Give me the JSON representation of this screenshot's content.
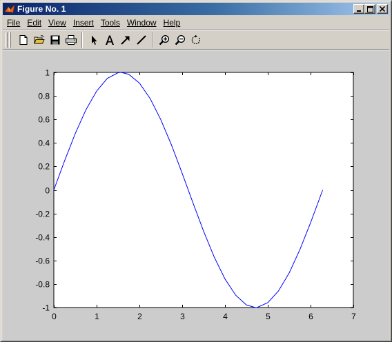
{
  "window": {
    "title": "Figure No. 1",
    "minimize_glyph": "_",
    "maximize_glyph": "□",
    "close_glyph": "×"
  },
  "menu": [
    {
      "label": "File",
      "name": "menu-file"
    },
    {
      "label": "Edit",
      "name": "menu-edit"
    },
    {
      "label": "View",
      "name": "menu-view"
    },
    {
      "label": "Insert",
      "name": "menu-insert"
    },
    {
      "label": "Tools",
      "name": "menu-tools"
    },
    {
      "label": "Window",
      "name": "menu-window"
    },
    {
      "label": "Help",
      "name": "menu-help"
    }
  ],
  "toolbar": {
    "icons": [
      "new-figure-icon",
      "open-file-icon",
      "save-icon",
      "print-icon",
      "edit-plot-arrow-icon",
      "insert-text-icon",
      "insert-arrow-icon",
      "insert-line-icon",
      "zoom-in-icon",
      "zoom-out-icon",
      "rotate-3d-icon"
    ]
  },
  "chart_data": {
    "type": "line",
    "function": "sin(x)",
    "x_range": [
      0,
      6.2832
    ],
    "xlim": [
      0,
      7
    ],
    "ylim": [
      -1,
      1
    ],
    "xticks": [
      "0",
      "1",
      "2",
      "3",
      "4",
      "5",
      "6",
      "7"
    ],
    "yticks": [
      "1",
      "0.8",
      "0.6",
      "0.4",
      "0.2",
      "0",
      "-0.2",
      "-0.4",
      "-0.6",
      "-0.8",
      "-1"
    ],
    "series": [
      {
        "color": "#0000ff",
        "x": [
          0,
          0.25,
          0.5,
          0.75,
          1.0,
          1.25,
          1.5,
          1.5708,
          1.75,
          2.0,
          2.25,
          2.5,
          2.75,
          3.0,
          3.25,
          3.5,
          3.75,
          4.0,
          4.25,
          4.5,
          4.7124,
          4.75,
          5.0,
          5.25,
          5.5,
          5.75,
          6.0,
          6.25,
          6.2832
        ],
        "y": [
          0,
          0.247,
          0.479,
          0.682,
          0.841,
          0.949,
          0.997,
          1.0,
          0.984,
          0.909,
          0.778,
          0.598,
          0.382,
          0.141,
          -0.108,
          -0.351,
          -0.572,
          -0.757,
          -0.895,
          -0.978,
          -1.0,
          -0.999,
          -0.959,
          -0.859,
          -0.706,
          -0.508,
          -0.279,
          -0.033,
          0
        ]
      }
    ],
    "grid": false,
    "title": "",
    "xlabel": "",
    "ylabel": ""
  },
  "colors": {
    "titlebar_start": "#0a246a",
    "titlebar_end": "#a6caf0",
    "figure_bg": "#cccccc",
    "axes_bg": "#ffffff",
    "line": "#0000ff"
  }
}
